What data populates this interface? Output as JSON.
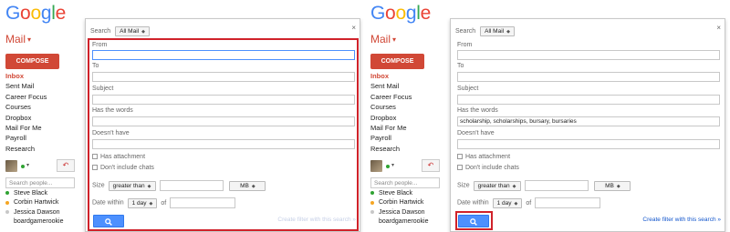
{
  "logo": {
    "letters": [
      {
        "char": "G",
        "color": "#4285f4"
      },
      {
        "char": "o",
        "color": "#ea4335"
      },
      {
        "char": "o",
        "color": "#fbbc05"
      },
      {
        "char": "g",
        "color": "#4285f4"
      },
      {
        "char": "l",
        "color": "#34a853"
      },
      {
        "char": "e",
        "color": "#ea4335"
      }
    ]
  },
  "gmail": {
    "mail_label": "Mail",
    "compose_label": "COMPOSE",
    "nav": [
      "Inbox",
      "Sent Mail",
      "Career Focus",
      "Courses",
      "Dropbox",
      "Mail For Me",
      "Payroll",
      "Research"
    ],
    "people_search_placeholder": "Search people...",
    "contacts": [
      {
        "name": "Steve Black",
        "status_color": "#2fa332"
      },
      {
        "name": "Corbin Hartwick",
        "status_color": "#f5a623"
      },
      {
        "name": "Jessica Dawson",
        "status_color": "#c8c8c8"
      },
      {
        "name": "boardgamerookie",
        "status_color": ""
      }
    ]
  },
  "filter_left": {
    "search_label": "Search",
    "search_scope": "All Mail",
    "from_label": "From",
    "from_value": "",
    "to_label": "To",
    "to_value": "",
    "subject_label": "Subject",
    "subject_value": "",
    "has_words_label": "Has the words",
    "has_words_value": "",
    "doesnt_have_label": "Doesn't have",
    "doesnt_have_value": "",
    "has_attachment_label": "Has attachment",
    "dont_include_chats_label": "Don't include chats",
    "size_label": "Size",
    "size_operator": "greater than",
    "size_unit": "MB",
    "date_label": "Date within",
    "date_range": "1 day",
    "of_label": "of",
    "create_filter_label": "Create filter with this search »",
    "close_label": "×"
  },
  "filter_right": {
    "search_label": "Search",
    "search_scope": "All Mail",
    "from_label": "From",
    "from_value": "",
    "to_label": "To",
    "to_value": "",
    "subject_label": "Subject",
    "subject_value": "",
    "has_words_label": "Has the words",
    "has_words_value": "scholarship, scholarships, bursary, bursaries",
    "doesnt_have_label": "Doesn't have",
    "doesnt_have_value": "",
    "has_attachment_label": "Has attachment",
    "dont_include_chats_label": "Don't include chats",
    "size_label": "Size",
    "size_operator": "greater than",
    "size_unit": "MB",
    "date_label": "Date within",
    "date_range": "1 day",
    "of_label": "of",
    "create_filter_label": "Create filter with this search »",
    "close_label": "×"
  },
  "colors": {
    "highlight": "#d0222a",
    "gmail_red": "#d14836",
    "button_blue": "#4d90fe",
    "link_blue": "#1155cc"
  }
}
